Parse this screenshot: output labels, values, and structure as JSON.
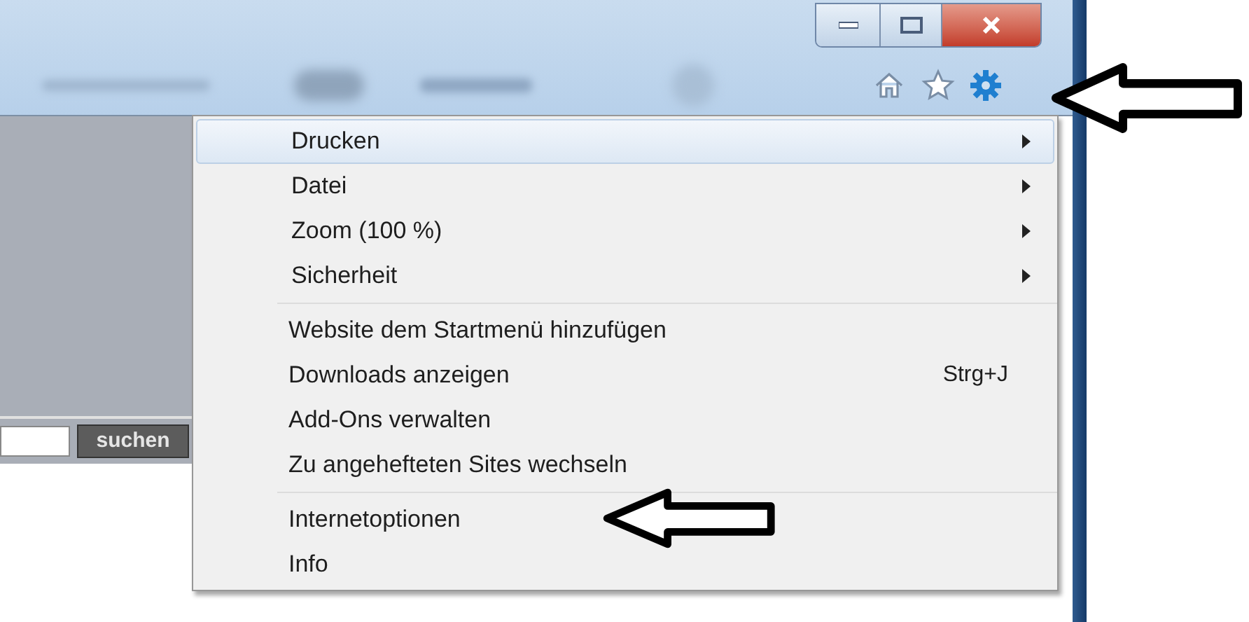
{
  "search": {
    "button": "suchen"
  },
  "menu": {
    "groups": [
      {
        "items": [
          {
            "label": "Drucken",
            "submenu": true,
            "selected": true
          },
          {
            "label": "Datei",
            "submenu": true,
            "selected": false
          },
          {
            "label": "Zoom (100 %)",
            "submenu": true,
            "selected": false
          },
          {
            "label": "Sicherheit",
            "submenu": true,
            "selected": false
          }
        ]
      },
      {
        "items": [
          {
            "label": "Website dem Startmenü hinzufügen",
            "submenu": false,
            "selected": false
          },
          {
            "label": "Downloads anzeigen",
            "shortcut": "Strg+J",
            "submenu": false,
            "selected": false
          },
          {
            "label": "Add-Ons verwalten",
            "submenu": false,
            "selected": false
          },
          {
            "label": "Zu angehefteten Sites wechseln",
            "submenu": false,
            "selected": false
          }
        ]
      },
      {
        "items": [
          {
            "label": "Internetoptionen",
            "submenu": false,
            "selected": false
          },
          {
            "label": "Info",
            "submenu": false,
            "selected": false
          }
        ]
      }
    ]
  }
}
